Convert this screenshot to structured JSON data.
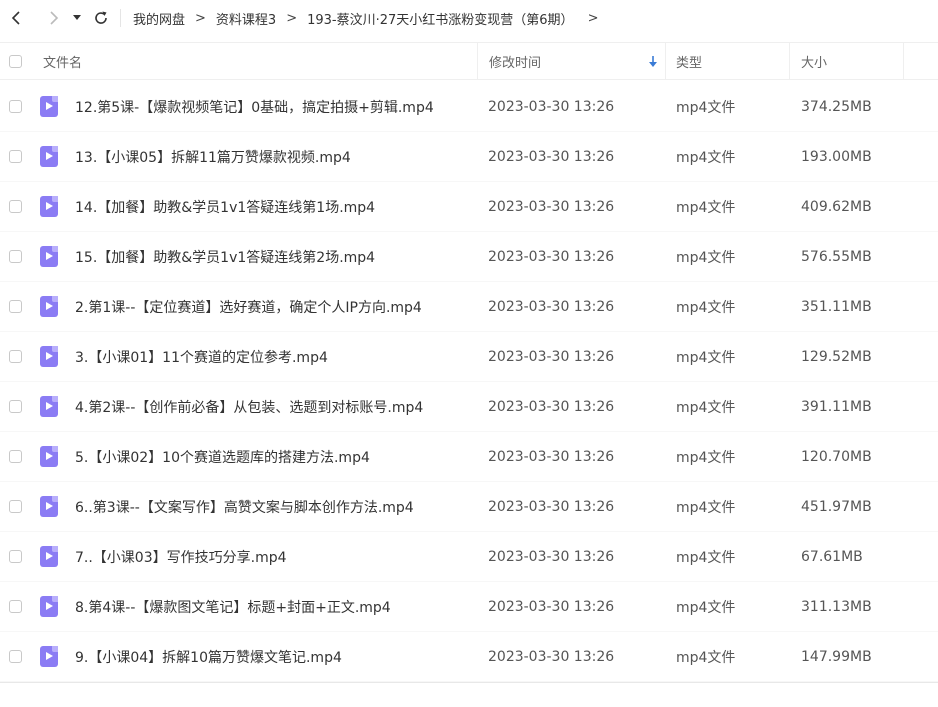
{
  "breadcrumb": {
    "items": [
      "我的网盘",
      "资料课程3",
      "193-蔡汶川·27天小红书涨粉变现营（第6期）"
    ],
    "separator": ">",
    "trailing": ">"
  },
  "columns": {
    "name": "文件名",
    "modified": "修改时间",
    "type": "类型",
    "size": "大小",
    "sort_icon": "sort-desc-arrow-icon"
  },
  "colors": {
    "accent": "#3a7bd5",
    "video_icon": "#8b7cf4"
  },
  "files": [
    {
      "name": "12.第5课-【爆款视频笔记】0基础，搞定拍摄+剪辑.mp4",
      "modified": "2023-03-30 13:26",
      "type": "mp4文件",
      "size": "374.25MB"
    },
    {
      "name": "13.【小课05】拆解11篇万赞爆款视频.mp4",
      "modified": "2023-03-30 13:26",
      "type": "mp4文件",
      "size": "193.00MB"
    },
    {
      "name": "14.【加餐】助教&学员1v1答疑连线第1场.mp4",
      "modified": "2023-03-30 13:26",
      "type": "mp4文件",
      "size": "409.62MB"
    },
    {
      "name": "15.【加餐】助教&学员1v1答疑连线第2场.mp4",
      "modified": "2023-03-30 13:26",
      "type": "mp4文件",
      "size": "576.55MB"
    },
    {
      "name": "2.第1课--【定位赛道】选好赛道，确定个人IP方向.mp4",
      "modified": "2023-03-30 13:26",
      "type": "mp4文件",
      "size": "351.11MB"
    },
    {
      "name": "3.【小课01】11个赛道的定位参考.mp4",
      "modified": "2023-03-30 13:26",
      "type": "mp4文件",
      "size": "129.52MB"
    },
    {
      "name": "4.第2课--【创作前必备】从包装、选题到对标账号.mp4",
      "modified": "2023-03-30 13:26",
      "type": "mp4文件",
      "size": "391.11MB"
    },
    {
      "name": "5.【小课02】10个赛道选题库的搭建方法.mp4",
      "modified": "2023-03-30 13:26",
      "type": "mp4文件",
      "size": "120.70MB"
    },
    {
      "name": "6..第3课--【文案写作】高赞文案与脚本创作方法.mp4",
      "modified": "2023-03-30 13:26",
      "type": "mp4文件",
      "size": "451.97MB"
    },
    {
      "name": "7..【小课03】写作技巧分享.mp4",
      "modified": "2023-03-30 13:26",
      "type": "mp4文件",
      "size": "67.61MB"
    },
    {
      "name": "8.第4课--【爆款图文笔记】标题+封面+正文.mp4",
      "modified": "2023-03-30 13:26",
      "type": "mp4文件",
      "size": "311.13MB"
    },
    {
      "name": "9.【小课04】拆解10篇万赞爆文笔记.mp4",
      "modified": "2023-03-30 13:26",
      "type": "mp4文件",
      "size": "147.99MB"
    }
  ]
}
